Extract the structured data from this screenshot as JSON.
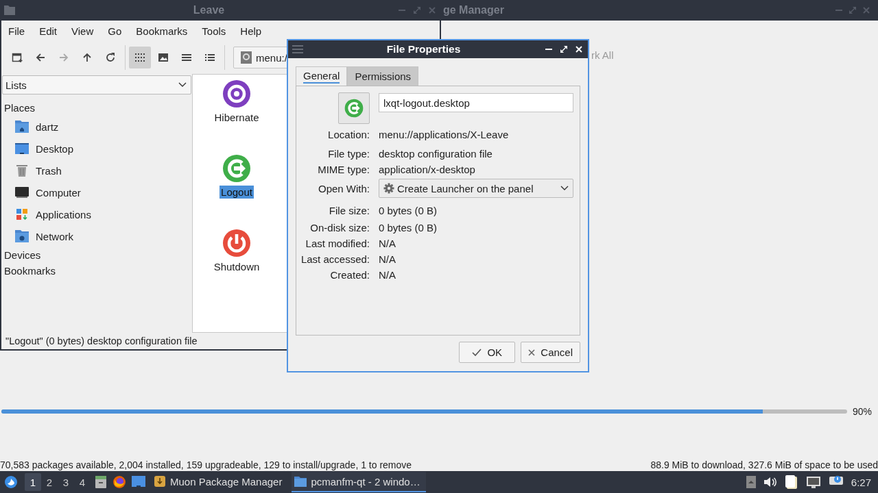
{
  "muon": {
    "title": "ge Manager",
    "toolbar_text": "rk All",
    "progress": {
      "level": 0.9,
      "reading": "90%"
    },
    "status_left": "70,583 packages available, 2,004 installed, 159 upgradeable, 129 to install/upgrade, 1 to remove",
    "status_right": "88.9 MiB to download, 327.6 MiB of space to be used"
  },
  "leave_window": {
    "title": "Leave",
    "menu": [
      "File",
      "Edit",
      "View",
      "Go",
      "Bookmarks",
      "Tools",
      "Help"
    ],
    "view_modes": [
      {
        "selected": true
      },
      {
        "selected": false
      },
      {
        "selected": false
      },
      {
        "selected": false
      }
    ],
    "location": "menu:/",
    "side_pane_mode": "Lists",
    "sections": [
      {
        "title": "Places",
        "items": [
          {
            "label": "dartz",
            "kind": "home"
          },
          {
            "label": "Desktop",
            "kind": "desktop"
          },
          {
            "label": "Trash",
            "kind": "trash"
          },
          {
            "label": "Computer",
            "kind": "computer"
          },
          {
            "label": "Applications",
            "kind": "applications"
          },
          {
            "label": "Network",
            "kind": "network"
          }
        ]
      },
      {
        "title": "Devices"
      },
      {
        "title": "Bookmarks"
      }
    ],
    "files": [
      {
        "label": "Hibernate",
        "kind": "hibernate",
        "selected": false
      },
      {
        "label": "Logout",
        "kind": "logout",
        "selected": true
      },
      {
        "label": "Shutdown",
        "kind": "shutdown",
        "selected": false
      }
    ],
    "status": "\"Logout\" (0 bytes) desktop configuration file"
  },
  "dialog": {
    "title": "File Properties",
    "tabs": [
      {
        "label": "General",
        "selected": true
      },
      {
        "label": "Permissions",
        "selected": false
      }
    ],
    "file_name": "lxqt-logout.desktop",
    "properties": [
      {
        "label": "Location:",
        "value": "menu://applications/X-Leave"
      },
      {
        "label": "File type:",
        "value": "desktop configuration file"
      },
      {
        "label": "MIME type:",
        "value": "application/x-desktop"
      },
      {
        "label": "Open With:",
        "value": "Create Launcher on the panel",
        "kind": "select"
      },
      {
        "label": "File size:",
        "value": "0 bytes (0 B)"
      },
      {
        "label": "On-disk size:",
        "value": "0 bytes (0 B)"
      },
      {
        "label": "Last modified:",
        "value": "N/A"
      },
      {
        "label": "Last accessed:",
        "value": "N/A"
      },
      {
        "label": "Created:",
        "value": "N/A"
      }
    ],
    "buttons": [
      {
        "label": "OK",
        "kind": "ok"
      },
      {
        "label": "Cancel",
        "kind": "cancel"
      }
    ]
  },
  "taskbar": {
    "desktops": [
      {
        "label": "1",
        "selected": true
      },
      {
        "label": "2",
        "selected": false
      },
      {
        "label": "3",
        "selected": false
      },
      {
        "label": "4",
        "selected": false
      }
    ],
    "tasks": [
      {
        "label": "Muon Package Manager",
        "kind": "package",
        "selected": false
      },
      {
        "label": "pcmanfm-qt - 2 windo…",
        "kind": "folder",
        "selected": true
      }
    ],
    "clock": "6:27"
  }
}
